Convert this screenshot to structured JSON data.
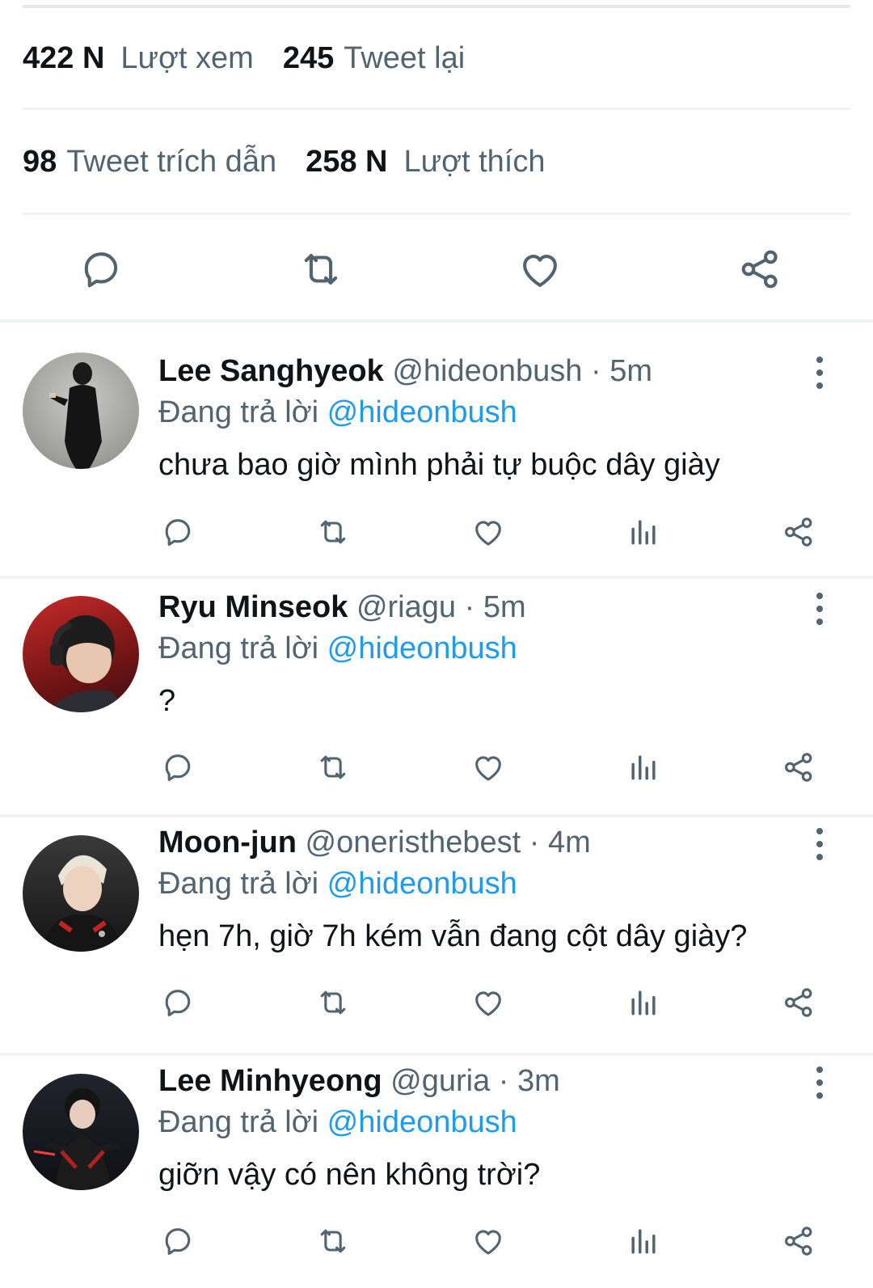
{
  "stats": {
    "views_count": "422 N",
    "views_label": "Lượt xem",
    "retweets_count": "245",
    "retweets_label": "Tweet lại",
    "quotes_count": "98",
    "quotes_label": "Tweet trích dẫn",
    "likes_count": "258 N",
    "likes_label": "Lượt thích"
  },
  "colors": {
    "text": "#0f1419",
    "muted": "#536471",
    "link": "#1d9bf0",
    "divider": "#eff3f4"
  },
  "replies": [
    {
      "name": "Lee Sanghyeok",
      "handle": "@hideonbush",
      "time": "5m",
      "reply_prefix": "Đang trả lời",
      "reply_to": "@hideonbush",
      "text": "chưa bao giờ mình phải tự buộc dây giày"
    },
    {
      "name": "Ryu Minseok",
      "handle": "@riagu",
      "time": "5m",
      "reply_prefix": "Đang trả lời",
      "reply_to": "@hideonbush",
      "text": "?"
    },
    {
      "name": "Moon-jun",
      "handle": "@oneristhebest",
      "time": "4m",
      "reply_prefix": "Đang trả lời",
      "reply_to": "@hideonbush",
      "text": "hẹn 7h, giờ 7h kém vẫn đang cột dây giày?"
    },
    {
      "name": "Lee Minhyeong",
      "handle": "@guria",
      "time": "3m",
      "reply_prefix": "Đang trả lời",
      "reply_to": "@hideonbush",
      "text": "giỡn vậy có nên không trời?"
    }
  ],
  "icons": {
    "reply": "reply-icon",
    "retweet": "retweet-icon",
    "like": "heart-icon",
    "views": "views-chart-icon",
    "share": "share-icon",
    "more": "more-vertical-icon"
  }
}
